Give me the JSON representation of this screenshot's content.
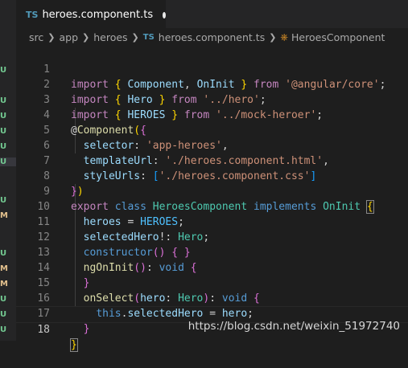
{
  "tab": {
    "badge": "TS",
    "label": "heroes.component.ts"
  },
  "breadcrumb": {
    "segments": [
      "src",
      "app",
      "heroes"
    ],
    "file_badge": "TS",
    "file": "heroes.component.ts",
    "symbol": "HeroesComponent"
  },
  "side_marks": [
    "U",
    "U",
    "U",
    "U",
    "U",
    "U",
    "U",
    "M",
    "U",
    "M",
    "M",
    "U",
    "U",
    "U"
  ],
  "editor": {
    "line_numbers": [
      "1",
      "2",
      "3",
      "4",
      "5",
      "6",
      "7",
      "8",
      "9",
      "10",
      "11",
      "12",
      "13",
      "14",
      "15",
      "16",
      "17",
      "18"
    ],
    "current_line": "18"
  },
  "watermark": "https://blog.csdn.net/weixin_51972740",
  "colors": {
    "keyword": "#569cd6",
    "control_keyword": "#c586c0",
    "string": "#ce9178",
    "type": "#4ec9b0",
    "function": "#dcdcaa",
    "variable": "#9cdcfe"
  }
}
